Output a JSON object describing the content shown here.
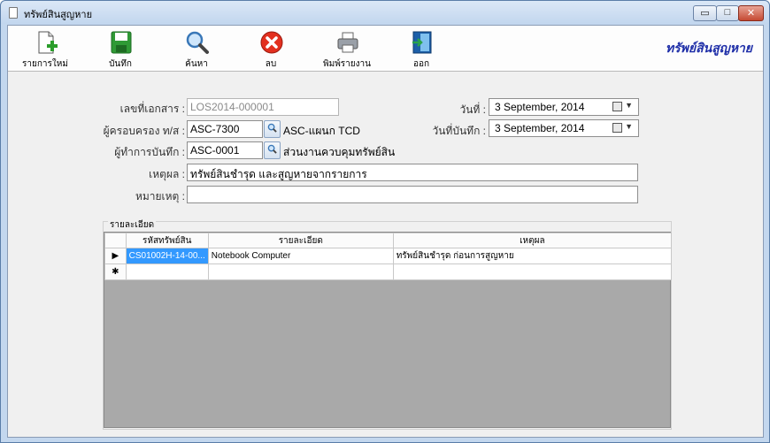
{
  "window": {
    "title": "ทรัพย์สินสูญหาย",
    "controls": {
      "minimize": "▭",
      "maximize": "□",
      "close": "✕"
    }
  },
  "toolbar": {
    "buttons": [
      {
        "label": "รายการใหม่",
        "icon": "new-document-icon"
      },
      {
        "label": "บันทึก",
        "icon": "save-disk-icon"
      },
      {
        "label": "ค้นหา",
        "icon": "magnifier-icon"
      },
      {
        "label": "ลบ",
        "icon": "delete-x-icon"
      },
      {
        "label": "พิมพ์รายงาน",
        "icon": "printer-icon"
      },
      {
        "label": "ออก",
        "icon": "exit-door-icon"
      }
    ],
    "brand": "ทรัพย์สินสูญหาย"
  },
  "form": {
    "doc_no": {
      "label": "เลขที่เอกสาร :",
      "value": "LOS2014-000001"
    },
    "owner": {
      "label": "ผู้ครอบครอง ท/ส :",
      "value": "ASC-7300",
      "desc": "ASC-แผนก TCD"
    },
    "recorder": {
      "label": "ผู้ทำการบันทึก :",
      "value": "ASC-0001",
      "desc": "ส่วนงานควบคุมทรัพย์สิน"
    },
    "reason": {
      "label": "เหตุผล :",
      "value": "ทรัพย์สินชำรุด และสูญหายจากรายการ"
    },
    "note": {
      "label": "หมายเหตุ :",
      "value": ""
    },
    "date": {
      "label": "วันที่ :",
      "value": "3 September, 2014"
    },
    "record_date": {
      "label": "วันที่บันทึก :",
      "value": "3 September, 2014"
    }
  },
  "details": {
    "caption": "รายละเอียด",
    "columns": [
      "รหัสทรัพย์สิน",
      "รายละเอียด",
      "เหตุผล"
    ],
    "rows": [
      {
        "marker": "▶",
        "code": "CS01002H-14-00...",
        "desc": "Notebook Computer",
        "reason": "ทรัพย์สินชำรุด ก่อนการสูญหาย"
      },
      {
        "marker": "✱",
        "code": "",
        "desc": "",
        "reason": ""
      }
    ]
  },
  "colors": {
    "brand": "#1f2fa8",
    "selected_cell": "#3399ff",
    "grid_empty": "#a9a9a9",
    "close_button": "#c54a33"
  }
}
